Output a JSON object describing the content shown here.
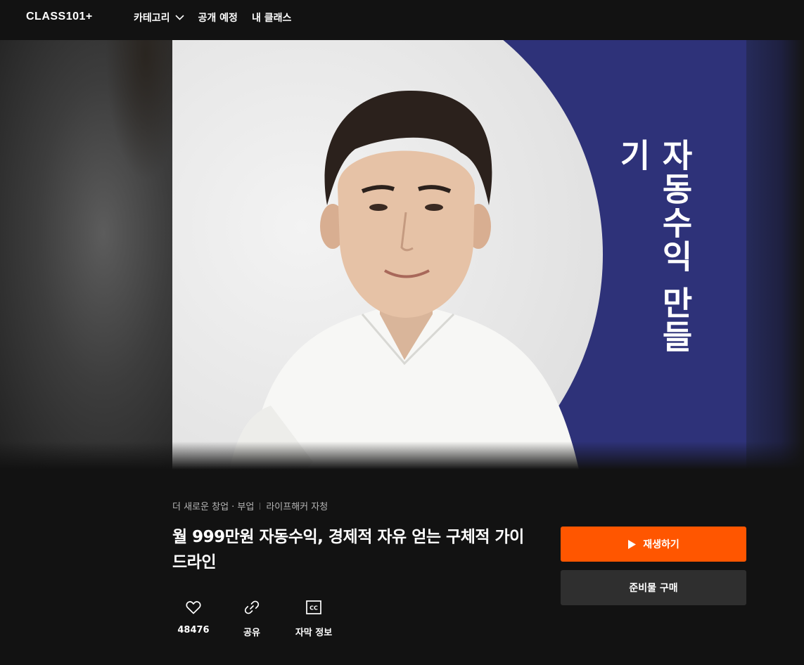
{
  "header": {
    "logo": "CLASS101+",
    "nav": [
      {
        "label": "카테고리",
        "icon": "chevron-down-icon"
      },
      {
        "label": "공개 예정"
      },
      {
        "label": "내 클래스"
      }
    ]
  },
  "hero": {
    "thumbnail_title": "자동수익 만들기",
    "colors": {
      "panel": "#2e3279",
      "circle": "#e6e6e6"
    }
  },
  "course": {
    "category": "더 새로운 창업 · 부업",
    "creator": "라이프해커 자청",
    "title": "월 999만원 자동수익, 경제적 자유 얻는 구체적 가이드라인"
  },
  "actions": [
    {
      "icon": "heart-icon",
      "label": "48476"
    },
    {
      "icon": "link-icon",
      "label": "공유"
    },
    {
      "icon": "cc-icon",
      "label": "자막 정보"
    }
  ],
  "buttons": {
    "play": "재생하기",
    "buy": "준비물 구매"
  },
  "colors": {
    "accent": "#ff5600",
    "background": "#121212",
    "secondary_button": "#2f2f2f"
  }
}
